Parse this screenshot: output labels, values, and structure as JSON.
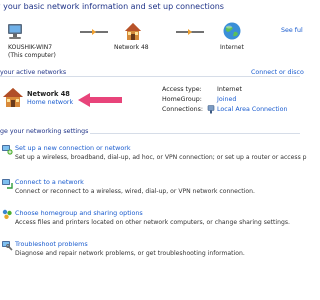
{
  "header": {
    "title": "w your basic network information and set up connections",
    "see_full": "See ful"
  },
  "map": {
    "computer_name": "KOUSHIK-WIN7",
    "computer_sub": "(This computer)",
    "network": "Network 48",
    "internet": "Internet"
  },
  "active": {
    "label": "your active networks",
    "connect_link": "Connect or disco",
    "network_name": "Network 48",
    "network_type": "Home network",
    "access_type_label": "Access type:",
    "access_type_value": "Internet",
    "homegroup_label": "HomeGroup:",
    "homegroup_value": "Joined",
    "connections_label": "Connections:",
    "connections_value": "Local Area Connection"
  },
  "settings": {
    "label": "ge your networking settings",
    "tasks": [
      {
        "title": "Set up a new connection or network",
        "desc": "Set up a wireless, broadband, dial-up, ad hoc, or VPN connection; or set up a router or access p"
      },
      {
        "title": "Connect to a network",
        "desc": "Connect or reconnect to a wireless, wired, dial-up, or VPN network connection."
      },
      {
        "title": "Choose homegroup and sharing options",
        "desc": "Access files and printers located on other network computers, or change sharing settings."
      },
      {
        "title": "Troubleshoot problems",
        "desc": "Diagnose and repair network problems, or get troubleshooting information."
      }
    ]
  },
  "colors": {
    "title": "#1e3287",
    "link": "#1a5ccf",
    "arrow": "#e8447a"
  }
}
